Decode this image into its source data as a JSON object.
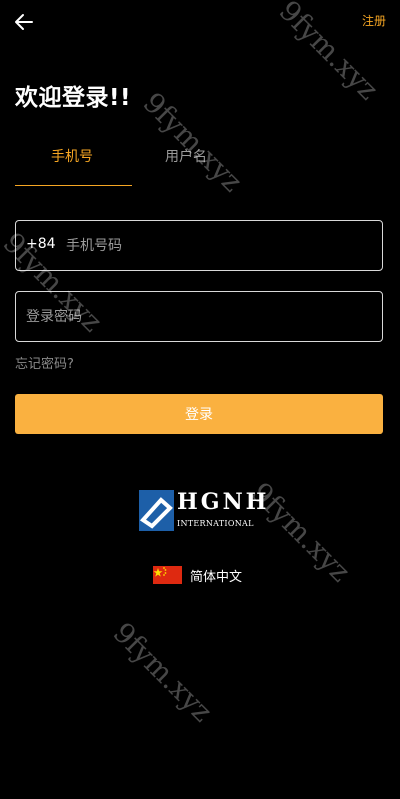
{
  "header": {
    "back_icon": "arrow-left-icon",
    "register_label": "注册"
  },
  "title": "欢迎登录!!",
  "tabs": [
    {
      "label": "手机号",
      "active": true
    },
    {
      "label": "用户名",
      "active": false
    }
  ],
  "phone_field": {
    "prefix": "+84",
    "placeholder": "手机号码",
    "value": ""
  },
  "password_field": {
    "placeholder": "登录密码",
    "value": ""
  },
  "forgot_label": "忘记密码?",
  "login_button_label": "登录",
  "logo": {
    "name": "HGNH",
    "subtitle": "INTERNATIONAL"
  },
  "language": {
    "flag_icon": "china-flag-icon",
    "label": "简体中文"
  },
  "watermark": "9fym.xyz",
  "colors": {
    "accent": "#f6a623",
    "button": "#fab140",
    "background": "#000000",
    "logo_blue": "#1d5fa8"
  }
}
